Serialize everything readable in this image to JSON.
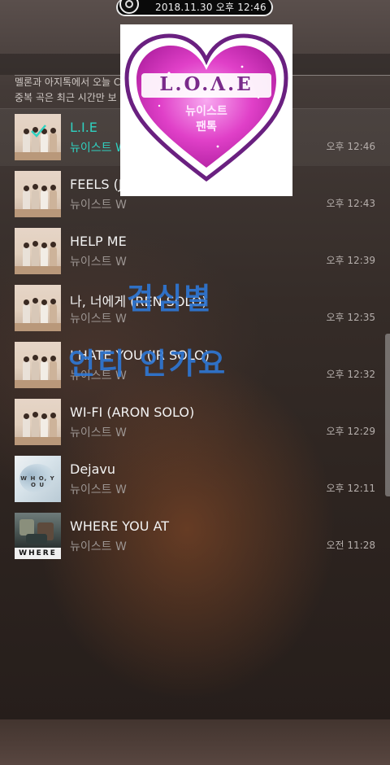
{
  "status": {
    "datetime": "2018.11.30 오후 12:46"
  },
  "notice": {
    "line1": "멜론과 아지톡에서 오늘 C",
    "line2": "중복 곡은 최근 시간만 보"
  },
  "sticker": {
    "logo": "L.O.Λ.E",
    "line1": "뉴이스트",
    "line2": "팬톡"
  },
  "overlay": {
    "line1": "검심별",
    "line2": "언티 인가요"
  },
  "tracks": [
    {
      "title": "L.I.E",
      "artist": "뉴이스트 W",
      "time": "오후 12:46",
      "selected": true
    },
    {
      "title": "FEELS (J",
      "artist": "뉴이스트 W",
      "time": "오후 12:43"
    },
    {
      "title": "HELP ME",
      "artist": "뉴이스트 W",
      "time": "오후 12:39"
    },
    {
      "title": "나, 너에게 (REN SOLO)",
      "artist": "뉴이스트 W",
      "time": "오후 12:35"
    },
    {
      "title": "I HATE YOU (JR SOLO)",
      "artist": "뉴이스트 W",
      "time": "오후 12:32"
    },
    {
      "title": "WI-FI (ARON SOLO)",
      "artist": "뉴이스트 W",
      "time": "오후 12:29"
    },
    {
      "title": "Dejavu",
      "artist": "뉴이스트 W",
      "time": "오후 12:11"
    },
    {
      "title": "WHERE YOU AT",
      "artist": "뉴이스트 W",
      "time": "오전 11:28"
    }
  ],
  "album_tags": {
    "dejavu": "W H O, Y O U",
    "where": "WHERE"
  },
  "icons": {
    "pill": "music-app-icon",
    "check": "checkmark-icon"
  },
  "colors": {
    "accent": "#2fd1c0",
    "overlay": "#2e78d6",
    "sticker": "#e040c8"
  }
}
